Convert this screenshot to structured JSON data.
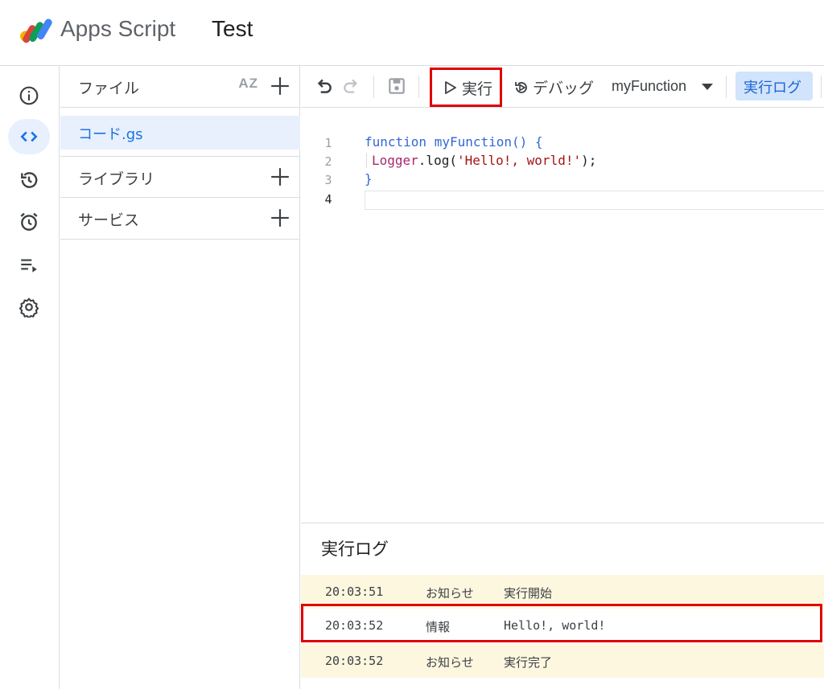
{
  "header": {
    "app_name": "Apps Script",
    "project_name": "Test"
  },
  "rail": {
    "items": [
      {
        "name": "info-icon"
      },
      {
        "name": "code-icon",
        "active": true
      },
      {
        "name": "history-icon"
      },
      {
        "name": "alarm-icon"
      },
      {
        "name": "executions-icon"
      },
      {
        "name": "settings-icon"
      }
    ]
  },
  "files": {
    "header_label": "ファイル",
    "sort_label": "AZ",
    "file_name": "コード.gs",
    "libraries_label": "ライブラリ",
    "services_label": "サービス"
  },
  "toolbar": {
    "run_label": "実行",
    "debug_label": "デバッグ",
    "function_select": "myFunction",
    "log_label": "実行ログ"
  },
  "code": {
    "line_numbers": [
      "1",
      "2",
      "3",
      "4"
    ],
    "line1_kw": "function",
    "line1_rest": " myFunction() {",
    "line2_obj": "Logger",
    "line2_mid": ".log(",
    "line2_str": "'Hello!, world!'",
    "line2_end": ");",
    "line3": "}"
  },
  "log": {
    "title": "実行ログ",
    "rows": [
      {
        "time": "20:03:51",
        "level": "お知らせ",
        "message": "実行開始"
      },
      {
        "time": "20:03:52",
        "level": "情報",
        "message": "Hello!, world!"
      },
      {
        "time": "20:03:52",
        "level": "お知らせ",
        "message": "実行完了"
      }
    ]
  },
  "colors": {
    "accent": "#1a73e8",
    "highlight_border": "#e00000",
    "notice_bg": "#fef7e0"
  }
}
